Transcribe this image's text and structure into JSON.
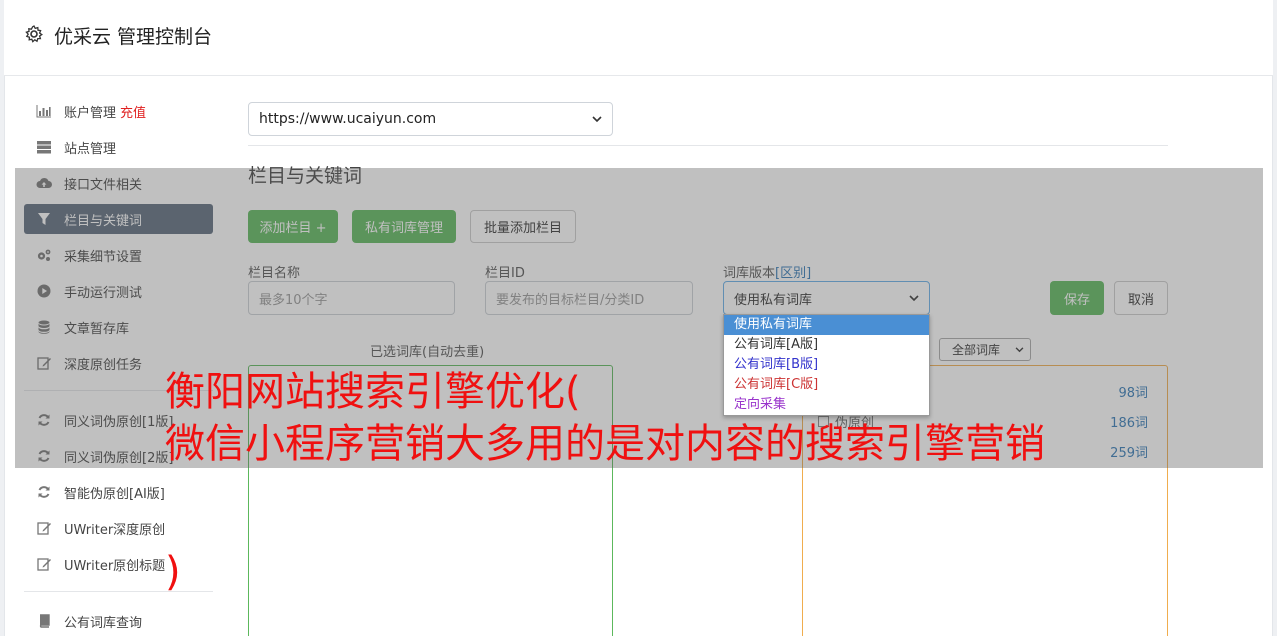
{
  "header": {
    "title": "优采云 管理控制台",
    "icon": "gear-icon"
  },
  "sidebar": {
    "items": [
      {
        "label": "账户管理",
        "badge": "充值",
        "icon": "bar-chart-icon"
      },
      {
        "label": "站点管理",
        "icon": "server-icon"
      },
      {
        "label": "接口文件相关",
        "icon": "cloud-upload-icon"
      },
      {
        "label": "栏目与关键词",
        "icon": "filter-icon",
        "active": true
      },
      {
        "label": "采集细节设置",
        "icon": "cogs-icon"
      },
      {
        "label": "手动运行测试",
        "icon": "play-circle-icon"
      },
      {
        "label": "文章暂存库",
        "icon": "database-icon"
      },
      {
        "label": "深度原创任务",
        "icon": "edit-icon"
      },
      {
        "label": "同义词伪原创[1版]",
        "icon": "refresh-icon"
      },
      {
        "label": "同义词伪原创[2版]",
        "icon": "refresh-icon"
      },
      {
        "label": "智能伪原创[AI版]",
        "icon": "refresh-icon"
      },
      {
        "label": "UWriter深度原创",
        "icon": "edit-icon"
      },
      {
        "label": "UWriter原创标题",
        "icon": "edit-icon"
      },
      {
        "label": "公有词库查询",
        "icon": "book-icon"
      }
    ]
  },
  "main": {
    "site_select": {
      "value": "https://www.ucaiyun.com"
    },
    "section_title": "栏目与关键词",
    "buttons": {
      "add_column": "添加栏目 +",
      "private_lib": "私有词库管理",
      "batch_add": "批量添加栏目",
      "save": "保存",
      "cancel": "取消"
    },
    "form": {
      "name_label": "栏目名称",
      "name_placeholder": "最多10个字",
      "id_label": "栏目ID",
      "id_placeholder": "要发布的目标栏目/分类ID",
      "version_label": "词库版本",
      "version_link": "[区别]",
      "version_value": "使用私有词库"
    },
    "version_options": [
      {
        "label": "使用私有词库",
        "color": "#ffffff"
      },
      {
        "label": "公有词库[A版]",
        "color": "#333333"
      },
      {
        "label": "公有词库[B版]",
        "color": "#3333cc"
      },
      {
        "label": "公有词库[C版]",
        "color": "#cc3333"
      },
      {
        "label": "定向采集",
        "color": "#9933cc"
      }
    ],
    "selected_label": "已选词库(自动去重)",
    "lib_filter": "全部词库",
    "libs": [
      {
        "name": "",
        "count": "98词"
      },
      {
        "name": "伪原创",
        "count": "186词"
      },
      {
        "name": "",
        "count": "259词"
      }
    ]
  },
  "ad": {
    "line1": "衡阳网站搜索引擎优化(",
    "line2": "微信小程序营销大多用的是对内容的搜索引擎营销",
    "line3": ")"
  },
  "colors": {
    "accent_green": "#5cb85c",
    "active_nav": "#5d6b7c",
    "ad_red": "#f01010"
  }
}
